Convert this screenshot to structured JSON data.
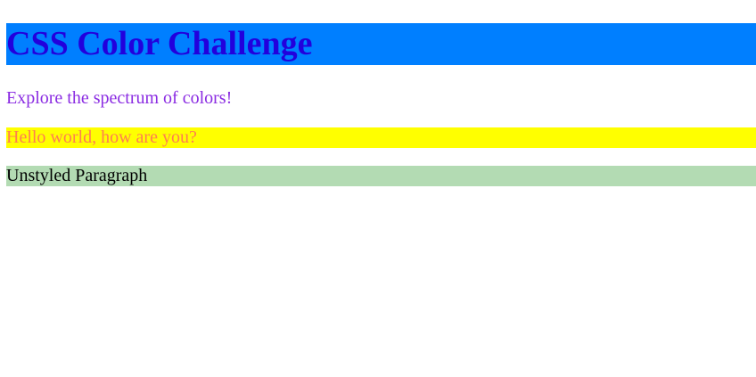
{
  "heading": {
    "title": "CSS Color Challenge"
  },
  "content": {
    "subtitle": "Explore the spectrum of colors!",
    "greeting": "Hello world, how are you?",
    "plain_paragraph": "Unstyled Paragraph"
  },
  "colors": {
    "title_background": "#007fff",
    "title_text": "#2200dd",
    "subtitle_text": "#8a2be2",
    "greeting_background": "#ffff00",
    "greeting_text": "#ff7f50",
    "plain_background": "#b3dbb3",
    "plain_text": "#000000",
    "page_background": "#ffffff"
  }
}
